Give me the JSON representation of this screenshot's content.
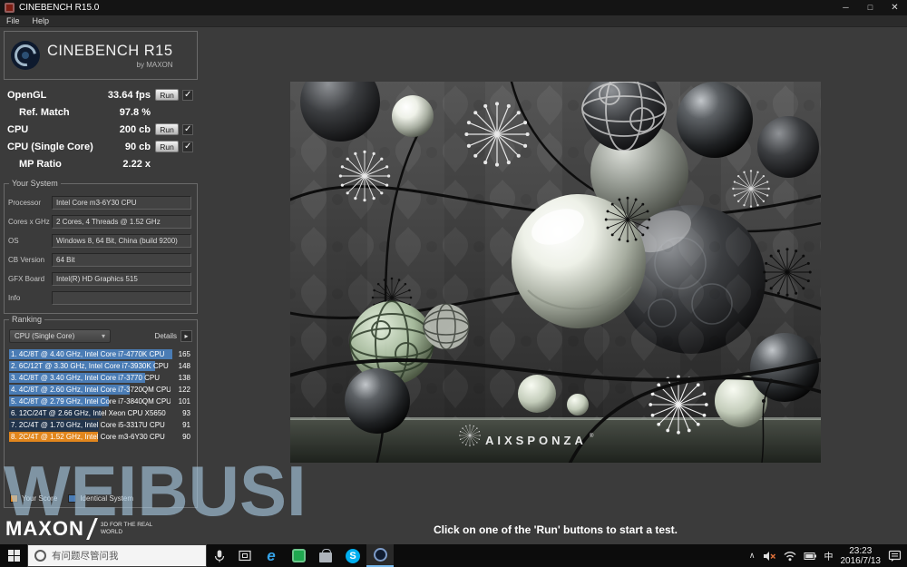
{
  "window": {
    "title": "CINEBENCH R15.0",
    "controls": {
      "minimize": "─",
      "maximize": "□",
      "close": "✕"
    }
  },
  "menu": {
    "items": [
      {
        "label": "File"
      },
      {
        "label": "Help"
      }
    ]
  },
  "app": {
    "logo_title": "CINEBENCH R15",
    "logo_subtitle": "by MAXON",
    "run_label": "Run",
    "benchmarks": [
      {
        "label": "OpenGL",
        "value": "33.64 fps",
        "run": true,
        "done": true,
        "indent": false
      },
      {
        "label": "Ref. Match",
        "value": "97.8 %",
        "run": false,
        "done": false,
        "indent": true
      },
      {
        "label": "CPU",
        "value": "200 cb",
        "run": true,
        "done": true,
        "indent": false
      },
      {
        "label": "CPU (Single Core)",
        "value": "90 cb",
        "run": true,
        "done": true,
        "indent": false
      },
      {
        "label": "MP Ratio",
        "value": "2.22 x",
        "run": false,
        "done": false,
        "indent": true
      }
    ]
  },
  "your_system": {
    "title": "Your System",
    "fields": [
      {
        "label": "Processor",
        "value": "Intel Core m3-6Y30 CPU"
      },
      {
        "label": "Cores x GHz",
        "value": "2 Cores, 4 Threads @ 1.52 GHz"
      },
      {
        "label": "OS",
        "value": "Windows 8, 64 Bit, China (build 9200)"
      },
      {
        "label": "CB Version",
        "value": "64 Bit"
      },
      {
        "label": "GFX Board",
        "value": "Intel(R) HD Graphics 515"
      },
      {
        "label": "Info",
        "value": ""
      }
    ]
  },
  "ranking": {
    "title": "Ranking",
    "filter_value": "CPU (Single Core)",
    "details_label": "Details",
    "max_score": 165,
    "entries": [
      {
        "label": "1. 4C/8T @ 4.40 GHz, Intel Core i7-4770K CPU",
        "score": 165,
        "kind": "blue"
      },
      {
        "label": "2. 6C/12T @ 3.30 GHz, Intel Core i7-3930K CPU",
        "score": 148,
        "kind": "blue"
      },
      {
        "label": "3. 4C/8T @ 3.40 GHz, Intel Core i7-3770 CPU",
        "score": 138,
        "kind": "blue"
      },
      {
        "label": "4. 4C/8T @ 2.60 GHz, Intel Core i7-3720QM CPU",
        "score": 122,
        "kind": "blue"
      },
      {
        "label": "5. 4C/8T @ 2.79 GHz, Intel Core i7-3840QM CPU",
        "score": 101,
        "kind": "blue"
      },
      {
        "label": "6. 12C/24T @ 2.66 GHz, Intel Xeon CPU X5650",
        "score": 93,
        "kind": "dark"
      },
      {
        "label": "7. 2C/4T @ 1.70 GHz, Intel Core i5-3317U CPU",
        "score": 91,
        "kind": "dark"
      },
      {
        "label": "8. 2C/4T @ 1.52 GHz, Intel Core m3-6Y30 CPU",
        "score": 90,
        "kind": "you"
      }
    ],
    "legend": [
      {
        "label": "Your Score",
        "color": "#e2861c"
      },
      {
        "label": "Identical System",
        "color": "#4a7cb5"
      }
    ]
  },
  "maxon": {
    "brand": "MAXON",
    "tagline": "3D FOR THE REAL WORLD"
  },
  "main": {
    "hint": "Click on one of the 'Run' buttons to start a test.",
    "scene_brand": "AIXSPONZA",
    "scene_brand_reg": "®"
  },
  "watermark": "WEIBUSI",
  "taskbar": {
    "search_placeholder": "有问题尽管问我",
    "icons": {
      "edge_glyph": "e",
      "skype_glyph": "S"
    },
    "chevron": "∧",
    "tray": {
      "ime": "中",
      "time": "23:23",
      "date": "2016/7/13"
    }
  }
}
